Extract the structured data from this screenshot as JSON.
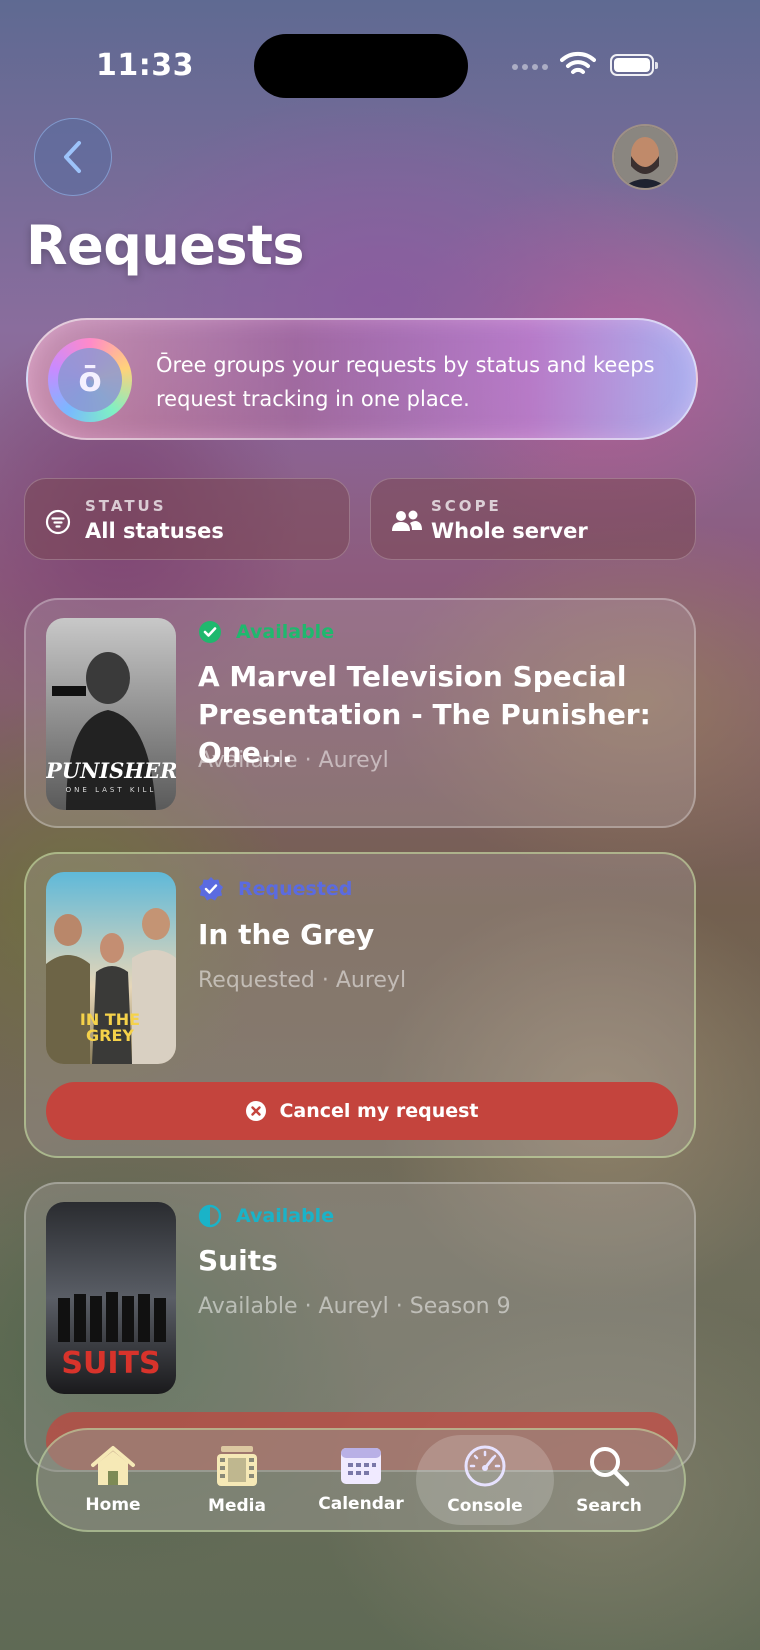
{
  "status_bar": {
    "time": "11:33"
  },
  "header": {
    "title": "Requests"
  },
  "banner": {
    "logo_letter": "ō",
    "text": "Ōree groups your requests by status and keeps request tracking in one place."
  },
  "filters": [
    {
      "label": "STATUS",
      "value": "All statuses",
      "icon": "filter-icon"
    },
    {
      "label": "SCOPE",
      "value": "Whole server",
      "icon": "people-icon"
    }
  ],
  "requests": [
    {
      "status": "Available",
      "status_color": "#1fb86e",
      "status_icon": "check-circle-icon",
      "title": "A Marvel Television Special Presentation - The Punisher: One...",
      "meta": "Available · Aureyl",
      "poster_text": "PUNISHER",
      "poster_subtext": "ONE LAST KILL"
    },
    {
      "status": "Requested",
      "status_color": "#5b6be0",
      "status_icon": "badge-check-icon",
      "title": "In the Grey",
      "meta": "Requested · Aureyl",
      "poster_text": "IN THE GREY",
      "action": "Cancel my request"
    },
    {
      "status": "Available",
      "status_color": "#1ab3c8",
      "status_icon": "half-circle-icon",
      "title": "Suits",
      "meta": "Available · Aureyl · Season 9",
      "poster_text": "SUITS"
    }
  ],
  "tabbar": [
    {
      "label": "Home",
      "icon": "home-icon"
    },
    {
      "label": "Media",
      "icon": "film-icon"
    },
    {
      "label": "Calendar",
      "icon": "calendar-icon"
    },
    {
      "label": "Console",
      "icon": "gauge-icon",
      "active": true
    },
    {
      "label": "Search",
      "icon": "search-icon"
    }
  ]
}
